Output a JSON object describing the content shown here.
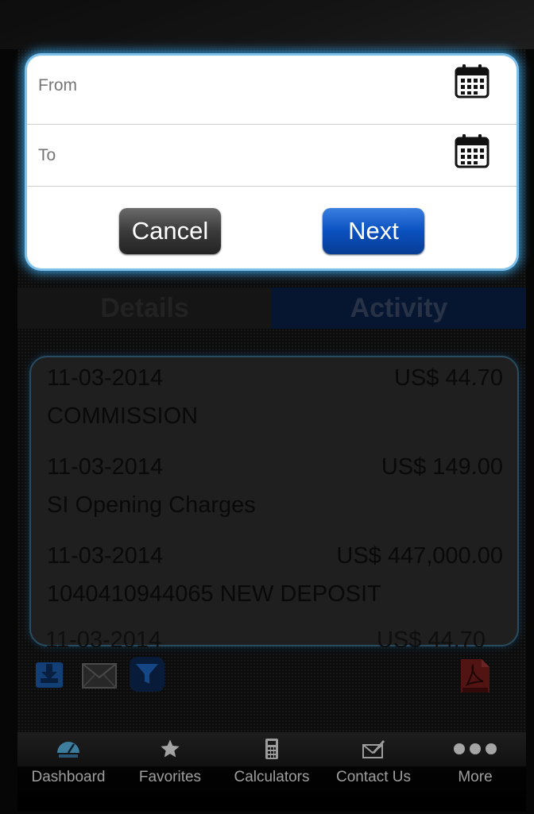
{
  "date_filter": {
    "from_placeholder": "From",
    "to_placeholder": "To",
    "from_value": "",
    "to_value": "",
    "cancel_label": "Cancel",
    "next_label": "Next"
  },
  "tabs": [
    {
      "label": "Details",
      "selected": false
    },
    {
      "label": "Activity",
      "selected": true
    }
  ],
  "transactions": [
    {
      "date": "11-03-2014",
      "amount": "US$ 44.70",
      "description": "COMMISSION"
    },
    {
      "date": "11-03-2014",
      "amount": "US$ 149.00",
      "description": "SI Opening Charges"
    },
    {
      "date": "11-03-2014",
      "amount": "US$ 447,000.00",
      "description": "1040410944065 NEW DEPOSIT"
    },
    {
      "date": "11-03-2014",
      "amount": "US$ 44.70",
      "description": ""
    }
  ],
  "actions": [
    "download-icon",
    "email-icon",
    "filter-icon",
    "pdf-icon"
  ],
  "tabbar": [
    {
      "label": "Dashboard",
      "icon": "speedometer-icon"
    },
    {
      "label": "Favorites",
      "icon": "star-icon"
    },
    {
      "label": "Calculators",
      "icon": "calculator-icon"
    },
    {
      "label": "Contact Us",
      "icon": "contact-icon"
    },
    {
      "label": "More",
      "icon": "more-dots-icon"
    }
  ],
  "colors": {
    "accent_blue": "#0b51c0",
    "dialog_glow": "#3ba6e6",
    "pdf_red": "#c62828"
  }
}
